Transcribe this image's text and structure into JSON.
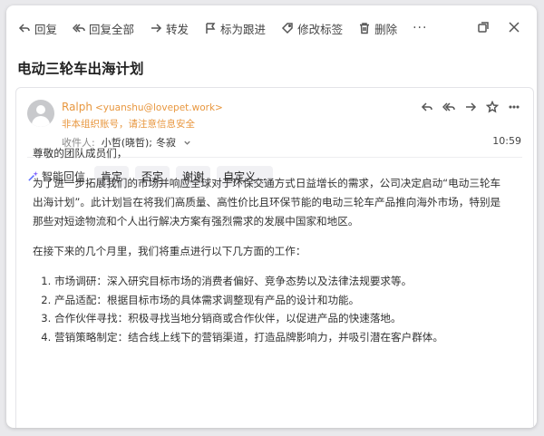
{
  "toolbar": {
    "reply": "回复",
    "reply_all": "回复全部",
    "forward": "转发",
    "flag": "标为跟进",
    "edit_tag": "修改标签",
    "delete": "删除",
    "more": "···"
  },
  "email": {
    "subject": "电动三轮车出海计划",
    "sender_name": "Ralph",
    "sender_address": "<yuanshu@lovepet.work>",
    "warning": "非本组织账号，请注意信息安全",
    "recipients_label": "收件人:",
    "recipients": [
      "小哲(晓哲);",
      "冬寂"
    ],
    "time": "10:59"
  },
  "smart_reply": {
    "label": "智能回信",
    "options": [
      "肯定",
      "否定",
      "谢谢",
      "自定义..."
    ]
  },
  "body": {
    "greeting": "尊敬的团队成员们，",
    "paragraph1": "为了进一步拓展我们的市场并响应全球对于环保交通方式日益增长的需求，公司决定启动“电动三轮车出海计划”。此计划旨在将我们高质量、高性价比且环保节能的电动三轮车产品推向海外市场，特别是那些对短途物流和个人出行解决方案有强烈需求的发展中国家和地区。",
    "paragraph2": "在接下来的几个月里，我们将重点进行以下几方面的工作：",
    "list": [
      "市场调研：深入研究目标市场的消费者偏好、竞争态势以及法律法规要求等。",
      "产品适配：根据目标市场的具体需求调整现有产品的设计和功能。",
      "合作伙伴寻找：积极寻找当地分销商或合作伙伴，以促进产品的快速落地。",
      "营销策略制定：结合线上线下的营销渠道，打造品牌影响力，并吸引潜在客户群体。"
    ]
  }
}
